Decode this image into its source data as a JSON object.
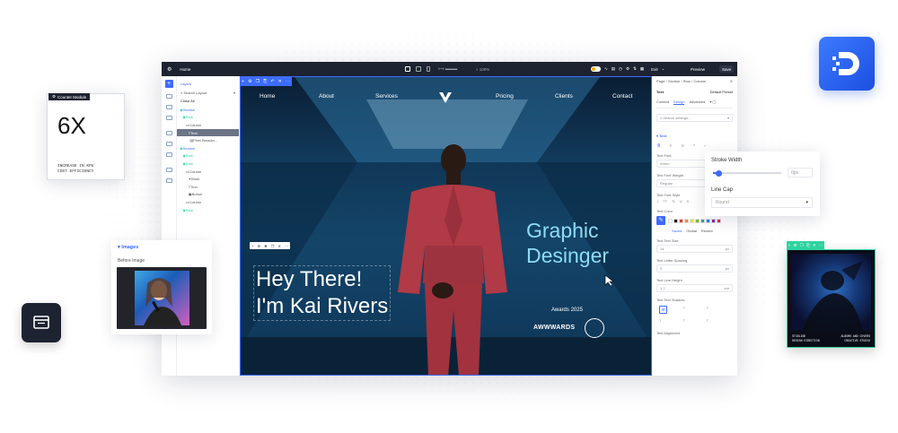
{
  "counter_module": {
    "tag": "Counter Module",
    "value": "6X",
    "caption_line1": "INCREASE IN KPU",
    "caption_line2": "COST EFFICIENCY"
  },
  "images_card": {
    "title": "Images",
    "before_label": "Before Image"
  },
  "topbar": {
    "page": "Home",
    "zoom": "100%",
    "exit": "Exit",
    "preview": "Preview",
    "save": "Save"
  },
  "layers": {
    "title": "Layers",
    "search": "Search Layout",
    "close_all": "Close All",
    "items": [
      "Section",
      "Row",
      "Column",
      "Text",
      "Pixel Breadcr...",
      "Section",
      "Row",
      "Row",
      "Column",
      "Blurb",
      "Text",
      "Button",
      "Column",
      "Row"
    ]
  },
  "hero": {
    "nav": [
      "Home",
      "About",
      "Services",
      "Pricing",
      "Clients",
      "Contact"
    ],
    "heading1": "Hey There!",
    "heading2": "I'm Kai Rivers",
    "role1": "Graphic",
    "role2": "Desinger",
    "awards_label": "Awards 2025",
    "awards_brand": "AWWWARDS"
  },
  "right_panel": {
    "breadcrumb": "Page › Section › Row › Column",
    "element": "Text",
    "preset": "Default Preset",
    "tabs": [
      "Content",
      "Design",
      "Advanced"
    ],
    "search": "Search settings...",
    "group": "Text",
    "text_font_label": "Text Font",
    "text_font_value": "Arimo",
    "weight_label": "Text Font Weight",
    "weight_value": "Regular",
    "style_label": "Text Font Style",
    "style_glyphs": [
      "I",
      "TT",
      "Tt",
      "U",
      "S"
    ],
    "color_label": "Text Color",
    "color_tabs": [
      "Saved",
      "Global",
      "Recent"
    ],
    "size_label": "Text Text Size",
    "size_value": "14",
    "size_unit": "px",
    "spacing_label": "Text Letter Spacing",
    "spacing_value": "0",
    "spacing_unit": "px",
    "lineheight_label": "Text Line Height",
    "lineheight_value": "1.7",
    "lineheight_unit": "em",
    "shadow_label": "Text Text Shadow",
    "align_label": "Text Alignment"
  },
  "stroke_popup": {
    "stroke_label": "Stroke Width",
    "stroke_value": "0px",
    "stroke_level": 0.08,
    "linecap_label": "Line Cap",
    "linecap_value": "Round"
  },
  "video_card": {
    "caption_left1": "STUDLINE",
    "caption_left2": "DESIGN DIRECTION",
    "caption_right1": "ALBUMS AND COVERS",
    "caption_right2": "CREATIVE STUDIO"
  },
  "colors": {
    "accent": "#3d6bff",
    "dark": "#1d2330",
    "swatches": [
      "#ffffff",
      "#111111",
      "#e53935",
      "#fb8c00",
      "#fdd835",
      "#7cb342",
      "#26a69a",
      "#1e88e5",
      "#8e24aa",
      "#e91e63"
    ]
  }
}
